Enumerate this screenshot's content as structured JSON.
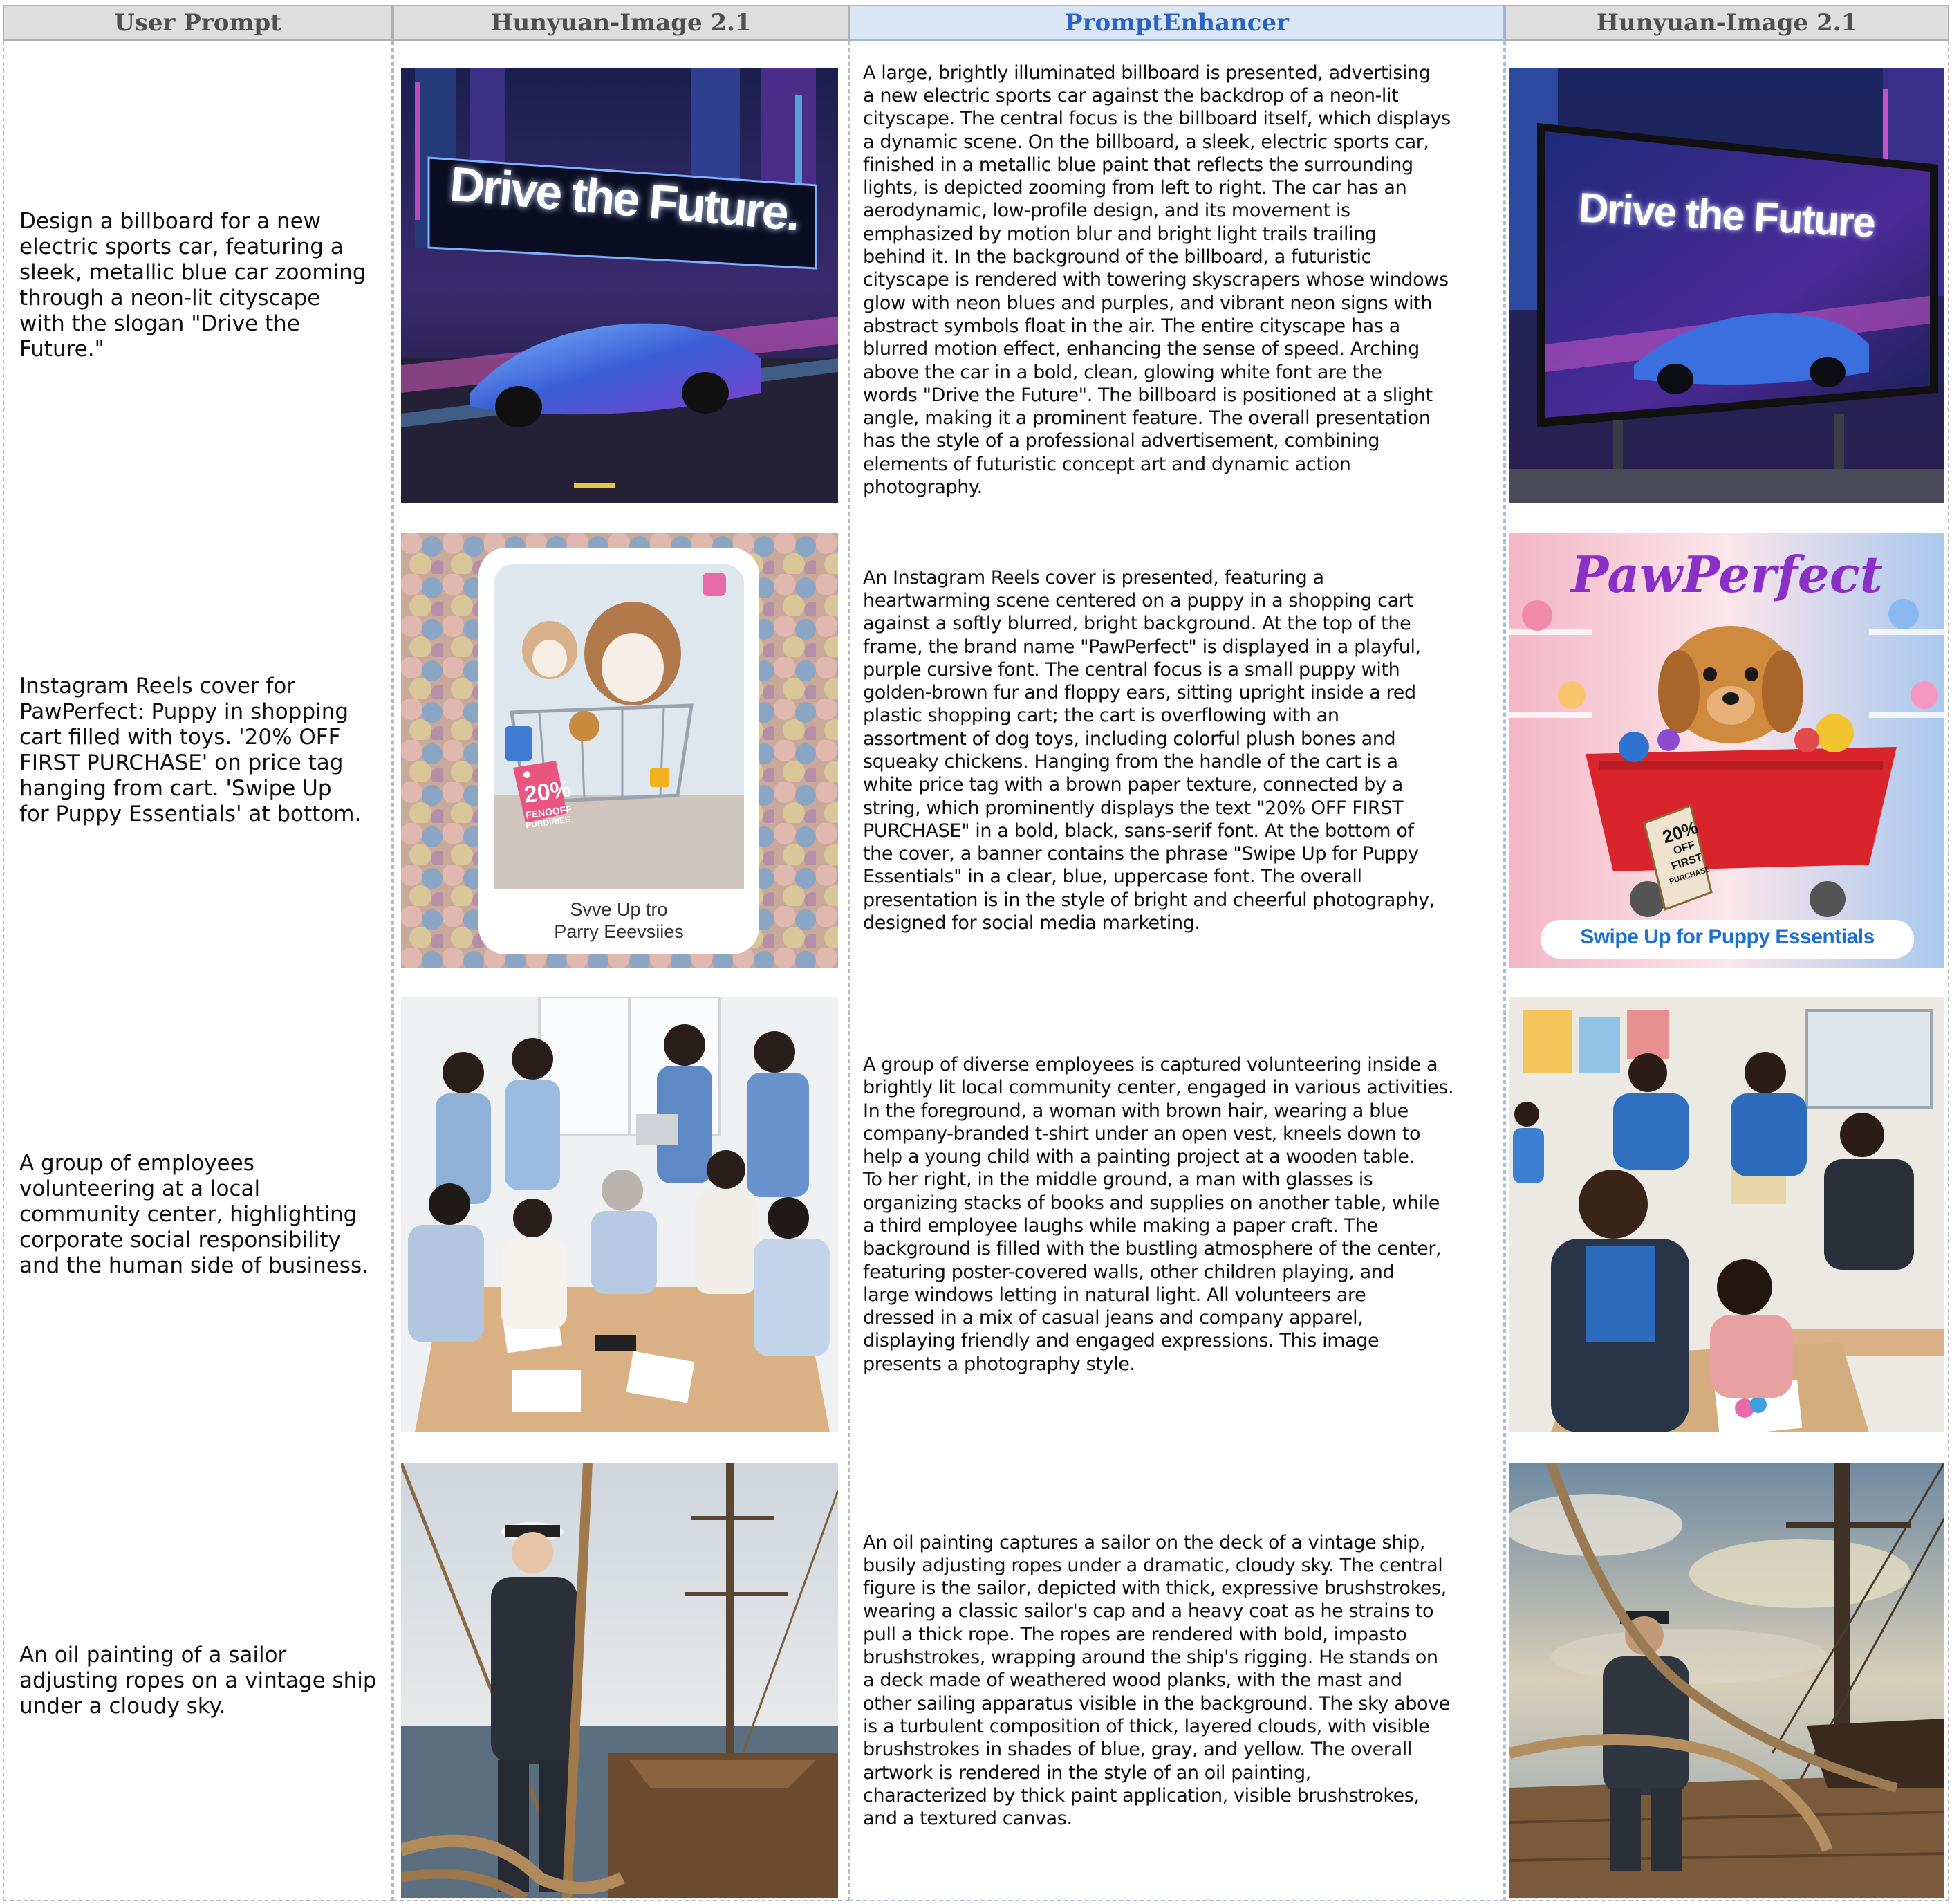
{
  "headers": {
    "user_prompt": "User Prompt",
    "model_a": "Hunyuan-Image 2.1",
    "enhancer": "PromptEnhancer",
    "model_b": "Hunyuan-Image 2.1"
  },
  "rows": [
    {
      "prompt": "Design a billboard for a new\nelectric sports car, featuring a\nsleek, metallic blue car zooming\nthrough a neon-lit cityscape\nwith the slogan \"Drive the\nFuture.\"",
      "enhanced": "A large, brightly illuminated billboard is presented, advertising\na new electric sports car against the backdrop of a neon-lit\ncityscape. The central focus is the billboard itself, which displays\na dynamic scene. On the billboard, a sleek, electric sports car,\nfinished in a metallic blue paint that reflects the surrounding\nlights, is depicted zooming from left to right. The car has an\naerodynamic, low-profile design, and its movement is\nemphasized by motion blur and bright light trails trailing\nbehind it. In the background of the billboard, a futuristic\ncityscape is rendered with towering skyscrapers whose windows\nglow with neon blues and purples, and vibrant neon signs with\nabstract symbols float in the air. The entire cityscape has a\nblurred motion effect, enhancing the sense of speed. Arching\nabove the car in a bold, clean, glowing white font are the\nwords \"Drive the Future\". The billboard is positioned at a slight\nangle, making it a prominent feature. The overall presentation\nhas the style of a professional advertisement, combining\nelements of futuristic concept art and dynamic action\nphotography.",
      "left_image_text": "Drive the Future.",
      "right_image_text": "Drive the Future"
    },
    {
      "prompt": "Instagram Reels cover for\nPawPerfect: Puppy in shopping\ncart filled with toys. '20% OFF\nFIRST PURCHASE' on price tag\nhanging from cart. 'Swipe Up\nfor Puppy Essentials' at bottom.",
      "enhanced": "An Instagram Reels cover is presented, featuring a\nheartwarming scene centered on a puppy in a shopping cart\nagainst a softly blurred, bright background. At the top of the\nframe, the brand name \"PawPerfect\" is displayed in a playful,\npurple cursive font. The central focus is a small puppy with\ngolden-brown fur and floppy ears, sitting upright inside a red\nplastic shopping cart; the cart is overflowing with an\nassortment of dog toys, including colorful plush bones and\nsqueaky chickens. Hanging from the handle of the cart is a\nwhite price tag with a brown paper texture, connected by a\nstring, which prominently displays the text \"20% OFF FIRST\nPURCHASE\" in a bold, black, sans-serif font. At the bottom of\nthe cover, a banner contains the phrase \"Swipe Up for Puppy\nEssentials\" in a clear, blue, uppercase font. The overall\npresentation is in the style of bright and cheerful photography,\ndesigned for social media marketing.",
      "left_image_text": {
        "tag_big": "20%",
        "tag_small_1": "FENOOFF",
        "tag_small_2": "PURDIRIEE",
        "bottom_1": "Svve Up tro",
        "bottom_2": "Parry Eeevsiies"
      },
      "right_image_text": {
        "brand": "PawPerfect",
        "tag_1": "20%",
        "tag_2": "OFF",
        "tag_3": "FIRST",
        "tag_4": "PURCHASE",
        "banner": "Swipe Up for Puppy Essentials"
      }
    },
    {
      "prompt": "A group of employees\nvolunteering at a local\ncommunity center, highlighting\ncorporate social responsibility\nand the human side of business.",
      "enhanced": "A group of diverse employees is captured volunteering inside a\nbrightly lit local community center, engaged in various activities.\nIn the foreground, a woman with brown hair, wearing a blue\ncompany-branded t-shirt under an open vest, kneels down to\nhelp a young child with a painting project at a wooden table.\nTo her right, in the middle ground, a man with glasses is\norganizing stacks of books and supplies on another table, while\na third employee laughs while making a paper craft. The\nbackground is filled with the bustling atmosphere of the center,\nfeaturing poster-covered walls, other children playing, and\nlarge windows letting in natural light. All volunteers are\ndressed in a mix of casual jeans and company apparel,\ndisplaying friendly and engaged expressions. This image\npresents a photography style."
    },
    {
      "prompt": "An oil painting of a sailor\nadjusting ropes on a vintage ship\nunder a cloudy sky.",
      "enhanced": "An oil painting captures a sailor on the deck of a vintage ship,\nbusily adjusting ropes under a dramatic, cloudy sky. The central\nfigure is the sailor, depicted with thick, expressive brushstrokes,\nwearing a classic sailor's cap and a heavy coat as he strains to\npull a thick rope. The ropes are rendered with bold, impasto\nbrushstrokes, wrapping around the ship's rigging. He stands on\na deck made of weathered wood planks, with the mast and\nother sailing apparatus visible in the background. The sky above\nis a turbulent composition of thick, layered clouds, with visible\nbrushstrokes in shades of blue, gray, and yellow. The overall\nartwork is rendered in the style of an oil painting,\ncharacterized by thick paint application, visible brushstrokes,\nand a textured canvas."
    }
  ]
}
